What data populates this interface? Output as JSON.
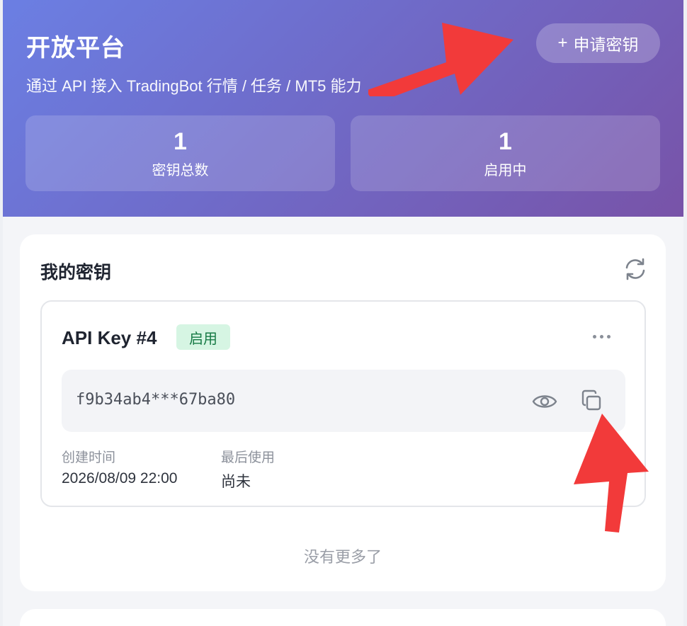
{
  "hero": {
    "title": "开放平台",
    "subtitle": "通过 API 接入 TradingBot 行情 / 任务 / MT5 能力",
    "apply_button": {
      "icon": "plus-icon",
      "label": "申请密钥"
    },
    "stats": [
      {
        "value": "1",
        "label": "密钥总数"
      },
      {
        "value": "1",
        "label": "启用中"
      }
    ]
  },
  "keys_card": {
    "title": "我的密钥",
    "refresh_icon": "refresh-icon",
    "items": [
      {
        "name": "API Key #4",
        "status": "启用",
        "masked_key": "f9b34ab4***67ba80",
        "created_label": "创建时间",
        "created_value": "2026/08/09 22:00",
        "last_used_label": "最后使用",
        "last_used_value": "尚未"
      }
    ],
    "no_more": "没有更多了"
  },
  "colors": {
    "hero_start": "#6b7fe3",
    "hero_end": "#7853a8",
    "badge_bg": "#d6f5e3",
    "badge_text": "#167a45",
    "annotation_arrow": "#f23a3a"
  }
}
